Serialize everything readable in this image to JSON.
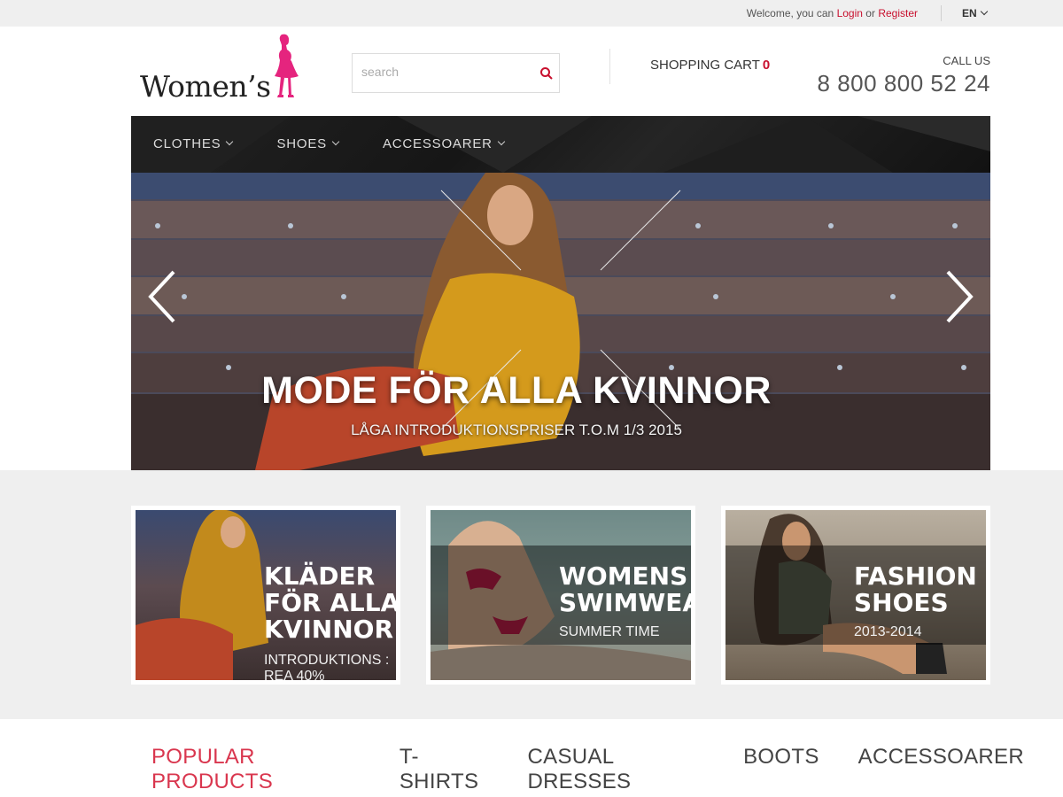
{
  "topbar": {
    "welcome_text": "Welcome, you can",
    "login_label": "Login",
    "or_text": "or",
    "register_label": "Register",
    "language": "EN"
  },
  "header": {
    "logo_text": "Women’s",
    "search_placeholder": "search",
    "cart_label": "SHOPPING CART",
    "cart_count": "0",
    "call_us_label": "CALL US",
    "phone": "8 800 800 52 24"
  },
  "nav": {
    "items": [
      {
        "label": "CLOTHES"
      },
      {
        "label": "SHOES"
      },
      {
        "label": "ACCESSOARER"
      }
    ]
  },
  "hero": {
    "title": "MODE FÖR ALLA KVINNOR",
    "subtitle": "LÅGA INTRODUKTIONSPRISER T.O.M 1/3 2015"
  },
  "promos": [
    {
      "title": "KLÄDER\nFÖR ALLA\nKVINNOR",
      "tag": "INTRODUKTIONS :\nREA 40%"
    },
    {
      "title": "WOMENS\nSWIMWEAR",
      "tag": "SUMMER TIME"
    },
    {
      "title": "FASHION\nSHOES",
      "tag": "2013-2014"
    }
  ],
  "tabs": [
    {
      "label": "POPULAR PRODUCTS",
      "active": true
    },
    {
      "label": "T-SHIRTS"
    },
    {
      "label": "CASUAL DRESSES"
    },
    {
      "label": "BOOTS"
    },
    {
      "label": "ACCESSOARER"
    }
  ],
  "colors": {
    "accent": "#c8102e",
    "tab_active": "#d9364e",
    "logo_pink": "#e5247e"
  },
  "icons": {
    "search": "search-icon",
    "cart": "none",
    "hero_prev": "chevron-left-icon",
    "hero_next": "chevron-right-icon"
  }
}
